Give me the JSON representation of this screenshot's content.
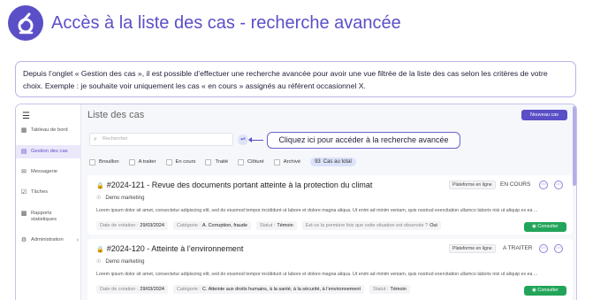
{
  "header": {
    "title": "Accès à la liste des cas - recherche avancée",
    "accent": "#5b4fc7"
  },
  "info": {
    "text": "Depuis l’onglet « Gestion des cas », il est possible d’effectuer une recherche avancée pour avoir une vue filtrée de la liste des cas selon les critères de votre choix. Exemple : je souhaite voir uniquement les cas « en cours » assignés au référent occasionnel X."
  },
  "sidebar": {
    "items": [
      {
        "label": "Tableau de bord",
        "icon": "dashboard-icon"
      },
      {
        "label": "Gestion des cas",
        "icon": "folder-icon"
      },
      {
        "label": "Messagerie",
        "icon": "message-icon"
      },
      {
        "label": "Tâches",
        "icon": "tasks-icon"
      },
      {
        "label": "Rapports statistiques",
        "icon": "chart-icon"
      },
      {
        "label": "Administration",
        "icon": "gear-icon"
      }
    ]
  },
  "main": {
    "title": "Liste des cas",
    "new_button": "Nouveau cas",
    "search_placeholder": "Rechercher",
    "callout": "Cliquez ici pour accéder à la recherche avancée",
    "filters": [
      "Brouillon",
      "A traiter",
      "En cours",
      "Traité",
      "Clôturé",
      "Archivé"
    ],
    "count_number": "93",
    "count_label": "Cas au total"
  },
  "cases": [
    {
      "title": "#2024-121 - Revue des documents portant atteinte à la protection du climat",
      "org": "Demo marketing",
      "platform": "Plateforme en ligne",
      "status": "EN COURS",
      "description": "Lorem ipsum dolor sit amet, consectetur adipiscing elit, sed do eiusmod tempor incididunt ut labore et dolore magna aliqua. Ut enim ad minim veniam, quis nostrud exercitation ullamco laboris nisi ut aliquip ex ea ...",
      "meta": [
        {
          "label": "Date de création :",
          "value": "29/03/2024"
        },
        {
          "label": "Catégorie :",
          "value": "A. Corruption, fraude"
        },
        {
          "label": "Statut :",
          "value": "Témoin"
        },
        {
          "label": "Est-ce la première fois que cette situation est observée ?",
          "value": "Oui"
        }
      ],
      "consult": "Consulter"
    },
    {
      "title": "#2024-120 - Atteinte à l’environnement",
      "org": "Demo marketing",
      "platform": "Plateforme en ligne",
      "status": "A TRAITER",
      "description": "Lorem ipsum dolor sit amet, consectetur adipiscing elit, sed do eiusmod tempor incididunt ut labore et dolore magna aliqua. Ut enim ad minim veniam, quis nostrud exercitation ullamco laboris nisi ut aliquip ex ea ...",
      "meta": [
        {
          "label": "Date de création :",
          "value": "29/03/2024"
        },
        {
          "label": "Catégorie :",
          "value": "C. Atteinte aux droits humains, à la santé, à la sécurité, à l’environnement"
        },
        {
          "label": "Statut :",
          "value": "Témoin"
        }
      ],
      "consult": "Consulter"
    }
  ]
}
